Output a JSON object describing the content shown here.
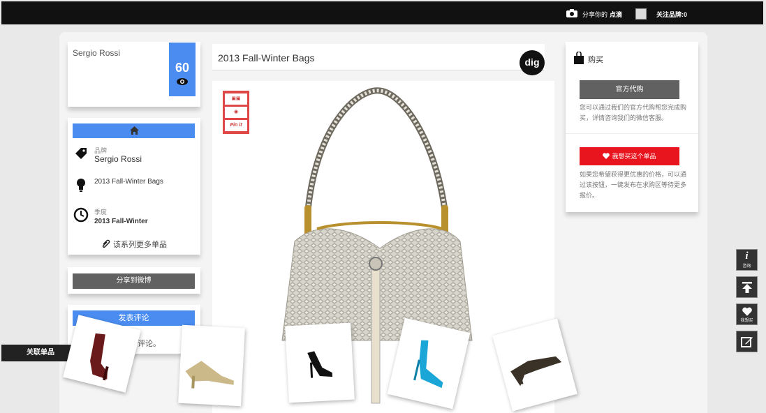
{
  "topbar": {
    "share_prefix": "分享你的",
    "share_highlight": "点滴",
    "follow_label": "关注品牌:0"
  },
  "brand_card": {
    "name": "Sergio Rossi",
    "view_count": "60"
  },
  "info": {
    "brand_label": "品牌",
    "brand_value": "Sergio Rossi",
    "collection_value": "2013 Fall-Winter Bags",
    "season_label": "季度",
    "season_value": "2013 Fall-Winter",
    "more_link": "该系列更多单品"
  },
  "share_weibo_label": "分享到微博",
  "comment": {
    "button_label": "发表评论",
    "text": "评论。"
  },
  "product_title": "2013 Fall-Winter Bags",
  "dig_label": "dig",
  "social": {
    "pinit_label": "Pin it"
  },
  "buy": {
    "header": "购买",
    "official_button": "官方代购",
    "official_desc": "您可以通过我们的官方代购帮您完成购买，详情咨询我们的微信客服。",
    "want_button": "我想买这个单品",
    "want_desc": "如果您希望获得更优惠的价格，可以通过该按钮，一键发布在求购区等待更多报价。"
  },
  "float_tools": {
    "info_caption": "咨询",
    "want_caption": "我想买"
  },
  "related_tab_label": "关联单品",
  "colors": {
    "accent_blue": "#4a8cf0",
    "want_red": "#e8141e",
    "dark_button": "#616161",
    "topbar_bg": "#111111"
  }
}
